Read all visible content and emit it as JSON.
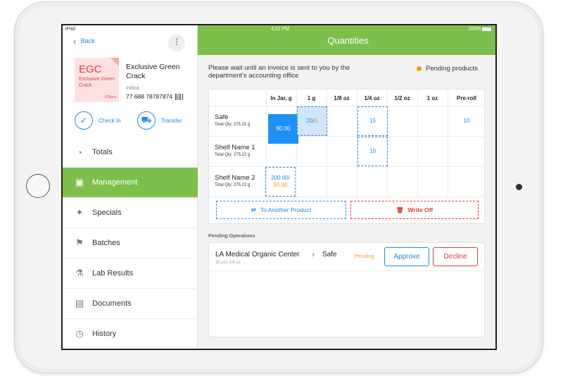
{
  "status_bar": {
    "device": "iPad",
    "time": "4:21 PM",
    "battery": "100%"
  },
  "sidebar": {
    "back_label": "Back",
    "more_label": "⋮",
    "product": {
      "card_code": "EGC",
      "card_name": "Exclusive Green Crack",
      "card_qty": "315pcs",
      "title": "Exclusive Green Crack",
      "type": "Indica",
      "code": "77 688 78787874"
    },
    "actions": {
      "check_in": "Check In",
      "transfer": "Transfer"
    },
    "items": [
      {
        "label": "Totals",
        "icon": "pie-chart-icon",
        "active": false
      },
      {
        "label": "Management",
        "icon": "jar-icon",
        "active": true
      },
      {
        "label": "Specials",
        "icon": "tag-icon",
        "active": false
      },
      {
        "label": "Batches",
        "icon": "flag-icon",
        "active": false
      },
      {
        "label": "Lab Results",
        "icon": "flask-icon",
        "active": false
      },
      {
        "label": "Documents",
        "icon": "documents-icon",
        "active": false
      },
      {
        "label": "History",
        "icon": "history-icon",
        "active": false
      }
    ]
  },
  "main": {
    "title": "Quantities",
    "notice": "Please wait until an invoice is sent to you by the department's accounting office",
    "pending_legend": "Pending products",
    "accent_color": "#7cbf4a",
    "table": {
      "columns": [
        "In Jar, g",
        "1 g",
        "1/8 oz",
        "1/4 oz",
        "1/2 oz",
        "1 oz",
        "Pre-roll"
      ],
      "rows": [
        {
          "name": "Safe",
          "total": "Total Qty: 275.22 g",
          "jar": "80.00",
          "one_g_a": "20/",
          "one_g_b": "5",
          "quarter": "15",
          "preroll": "10"
        },
        {
          "name": "Shelf Name 1",
          "total": "Total Qty: 275.22 g",
          "quarter": "10"
        },
        {
          "name": "Shelf Name 2",
          "total": "Total Qty: 275.22 g",
          "jar_a": "200.00/",
          "jar_b": "50.00"
        }
      ]
    },
    "buttons": {
      "to_another_product": "To Another Product",
      "write_off": "Write Off"
    },
    "pending": {
      "title": "Pending Operations",
      "operations": [
        {
          "from": "LA Medical Organic Center",
          "to": "Safe",
          "sub": "25 pcs 1/8 oz",
          "status": "Pending",
          "approve": "Approve",
          "decline": "Decline"
        }
      ]
    }
  }
}
